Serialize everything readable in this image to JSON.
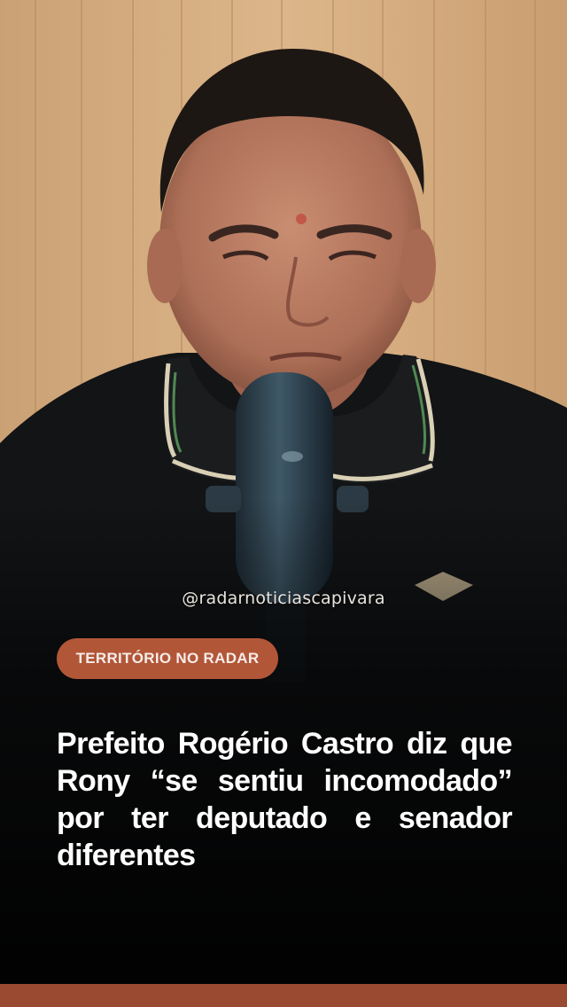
{
  "post": {
    "handle": "@radarnoticiascapivara",
    "category_tag": "TERRITÓRIO NO RADAR",
    "headline": "Prefeito Rogério Castro diz que Rony “se sentiu incomodado” por ter deputado e senador diferentes"
  },
  "colors": {
    "tag_bg": "#b25638",
    "bottom_bar": "#9a4a31",
    "background": "#0b0b0c"
  }
}
